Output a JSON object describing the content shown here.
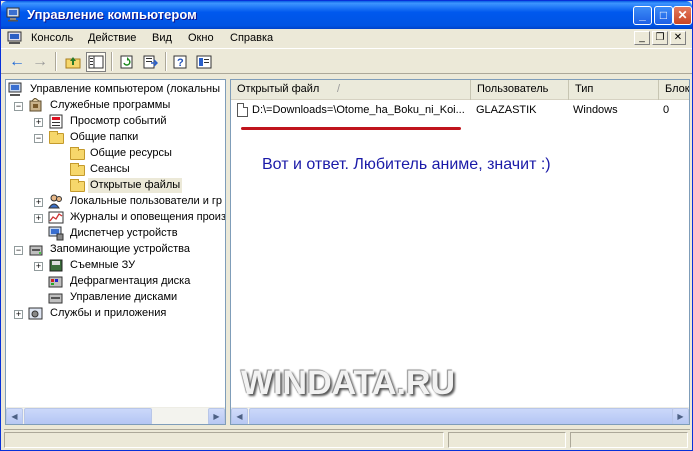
{
  "window": {
    "title": "Управление компьютером",
    "minimize_glyph": "_",
    "maximize_glyph": "□",
    "close_glyph": "✕"
  },
  "menubar": {
    "items": [
      "Консоль",
      "Действие",
      "Вид",
      "Окно",
      "Справка"
    ],
    "mdi_minimize": "_",
    "mdi_restore": "❐",
    "mdi_close": "✕"
  },
  "toolbar": {
    "back_glyph": "←",
    "forward_glyph": "→",
    "icons": [
      "up-folder-icon",
      "show-hide-tree-icon",
      "refresh-icon",
      "export-list-icon",
      "help-icon",
      "properties-icon"
    ]
  },
  "tree": {
    "root": "Управление компьютером (локальны",
    "system_tools": "Служебные программы",
    "event_viewer": "Просмотр событий",
    "shared_folders": "Общие папки",
    "shares": "Общие ресурсы",
    "sessions": "Сеансы",
    "open_files": "Открытые файлы",
    "local_users": "Локальные пользователи и гр",
    "perf_logs": "Журналы и оповещения произ",
    "device_manager": "Диспетчер устройств",
    "storage": "Запоминающие устройства",
    "removable": "Съемные ЗУ",
    "defrag": "Дефрагментация диска",
    "disk_mgmt": "Управление дисками",
    "services_apps": "Службы и приложения",
    "expand_minus": "−",
    "expand_plus": "+"
  },
  "list": {
    "columns": [
      "Открытый файл",
      "Пользователь",
      "Тип",
      "Блок"
    ],
    "sort_indicator": "/",
    "rows": [
      {
        "file": "D:\\=Downloads=\\Otome_ha_Boku_ni_Koi...",
        "user": "GLAZASTIK",
        "type": "Windows",
        "locks": "0"
      }
    ],
    "annotation": "Вот и ответ. Любитель аниме, значит :)",
    "watermark": "WINDATA.RU"
  },
  "scroll": {
    "left": "◀",
    "right": "▶"
  },
  "colors": {
    "titlebar": "#0054e3",
    "annotation": "#1a1aa8",
    "underline": "#c0141c"
  }
}
